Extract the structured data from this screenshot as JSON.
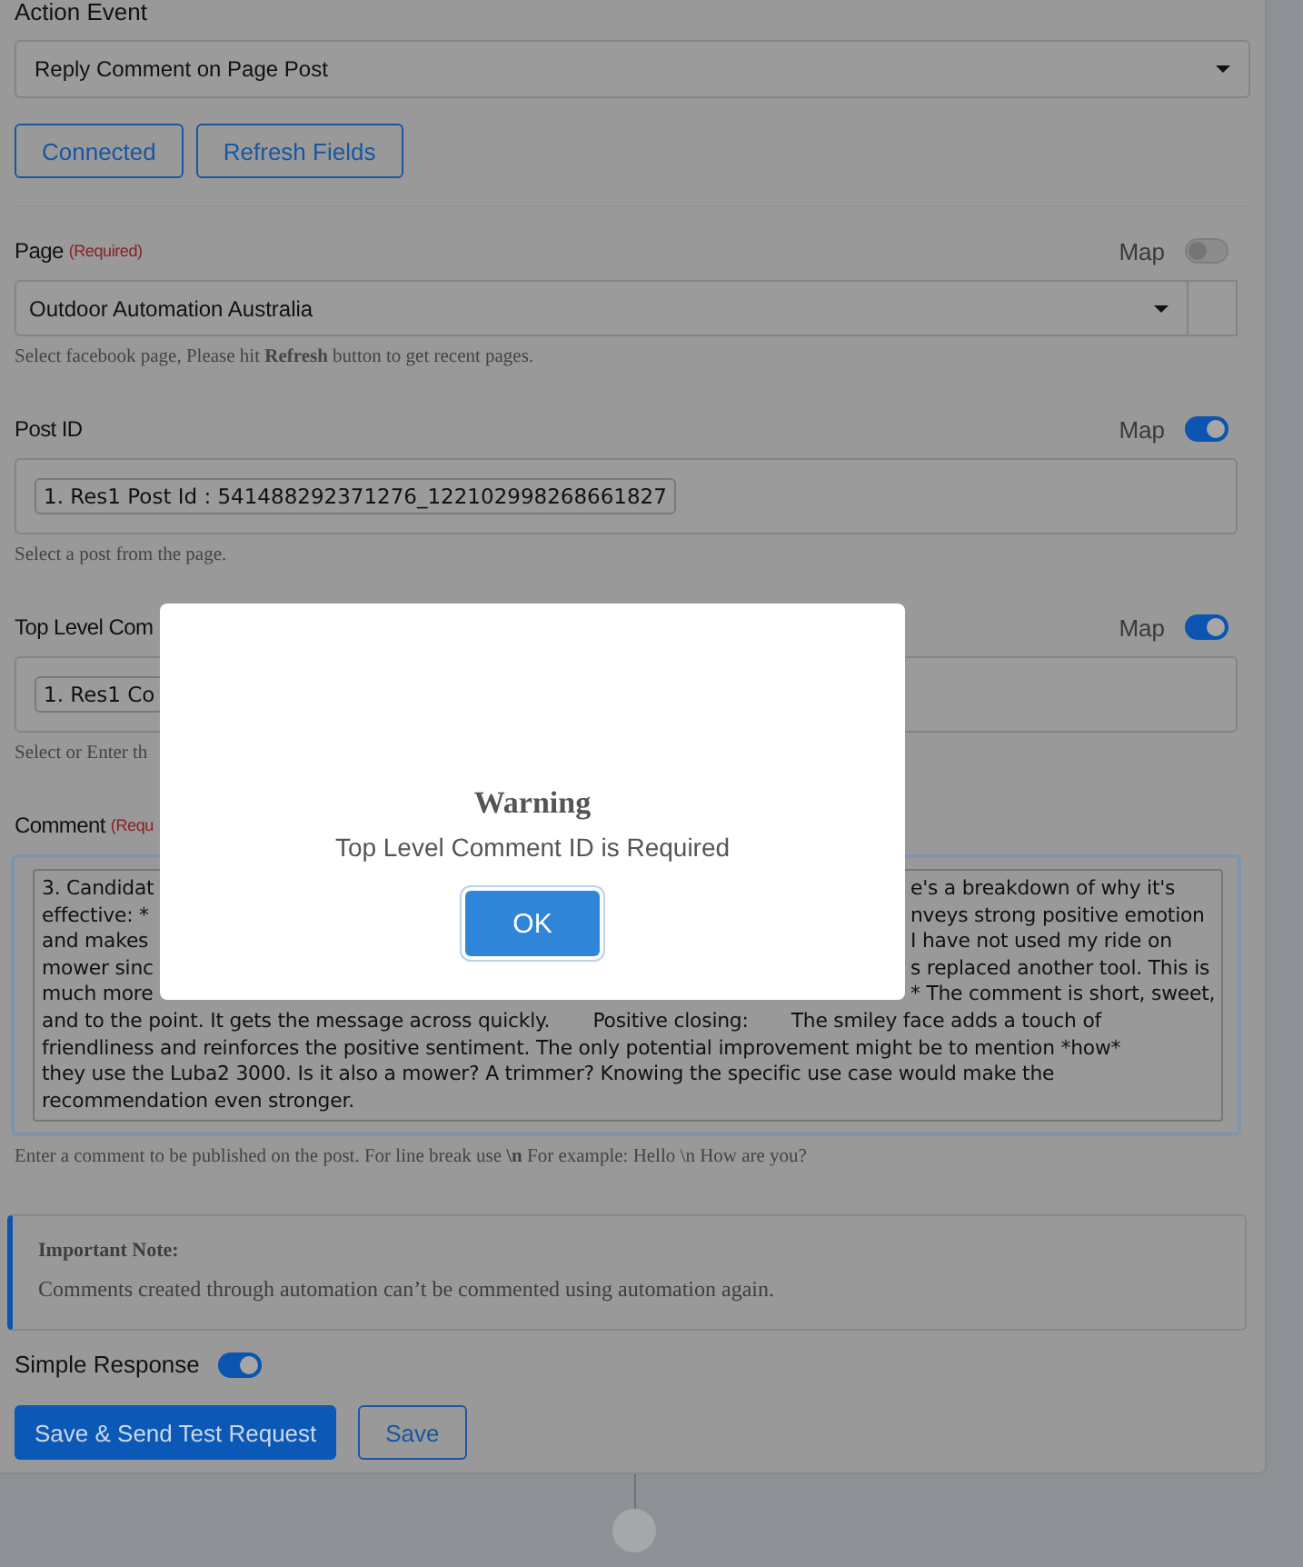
{
  "action_event": {
    "label": "Action Event",
    "value": "Reply Comment on Page Post"
  },
  "top_buttons": [
    {
      "label": "Connected"
    },
    {
      "label": "Refresh Fields"
    }
  ],
  "fields": [
    {
      "kind": "select",
      "label": "Page",
      "required": "(Required)",
      "map_label": "Map",
      "map_on": false,
      "value": "Outdoor Automation Australia",
      "help": "Select facebook page, Please hit **Refresh** button to get recent pages."
    },
    {
      "kind": "chip",
      "label": "Post ID",
      "map_label": "Map",
      "map_on": true,
      "value": "1. Res1 Post Id : 541488292371276_122102998268661827",
      "help": "Select a post from the page."
    },
    {
      "kind": "chip",
      "label": "Top Level Com",
      "map_label": "Map",
      "map_on": true,
      "value": "1. Res1 Co",
      "help": "Select or Enter th"
    },
    {
      "kind": "textarea",
      "label": "Comment",
      "required": "(Requ",
      "lines": [
        {
          "left": "3. Candidat",
          "right": "e's a breakdown of why it's"
        },
        {
          "left": "effective: *",
          "right": "nveys strong positive emotion"
        },
        {
          "left": "and makes",
          "right": "I have not used my ride on"
        },
        {
          "left": "mower sinc",
          "right": "s replaced another tool. This is"
        },
        {
          "left": "much more",
          "right": "* The comment is short, sweet,"
        },
        {
          "left": "and to the point. It gets the message across quickly.       Positive closing:       The smiley face adds a touch of"
        },
        {
          "left": "friendliness and reinforces the positive sentiment. The only potential improvement might be to mention *how*"
        },
        {
          "left": "they use the Luba2 3000. Is it also a mower? A trimmer? Knowing the specific use case would make the"
        },
        {
          "left": "recommendation even stronger."
        }
      ],
      "help": "Enter a comment to be published on the post. For line break use **\\n** For example: Hello \\n How are you?"
    }
  ],
  "note": {
    "title": "Important Note:",
    "text": "Comments created through automation can’t be commented using automation again."
  },
  "simple_response": {
    "label": "Simple Response",
    "on": true
  },
  "actions": [
    {
      "kind": "primary",
      "label": "Save & Send Test Request"
    },
    {
      "kind": "outline",
      "label": "Save"
    }
  ],
  "dialog": {
    "title": "Warning",
    "message": "Top Level Comment ID is Required",
    "button": "OK"
  }
}
